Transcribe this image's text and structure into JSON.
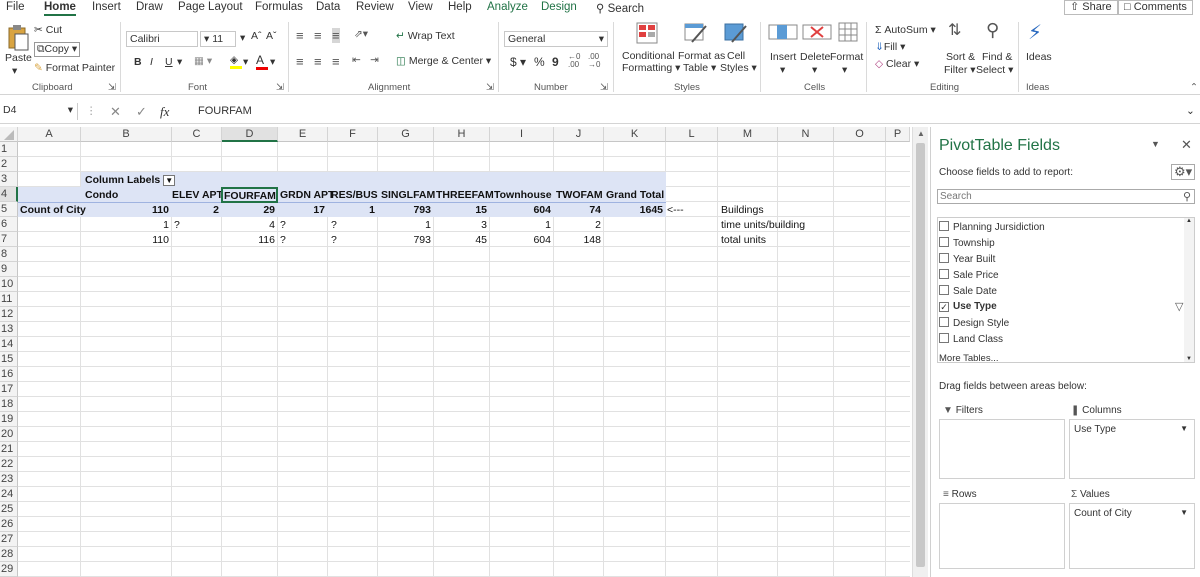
{
  "tabs": [
    "File",
    "Home",
    "Insert",
    "Draw",
    "Page Layout",
    "Formulas",
    "Data",
    "Review",
    "View",
    "Help",
    "Analyze",
    "Design"
  ],
  "search_label": "Search",
  "share_label": "Share",
  "comments_label": "Comments",
  "ribbon": {
    "paste": "Paste",
    "cut": "Cut",
    "copy": "Copy",
    "format_painter": "Format Painter",
    "clipboard": "Clipboard",
    "font_name": "Calibri",
    "font_size": "11",
    "font_group": "Font",
    "bold": "B",
    "italic": "I",
    "underline": "U",
    "wrap_text": "Wrap Text",
    "merge_center": "Merge & Center",
    "alignment": "Alignment",
    "number_format": "General",
    "currency": "$",
    "percent": "%",
    "comma": "9",
    "number": "Number",
    "conditional": "Conditional",
    "formatting": "Formatting",
    "format_as": "Format as",
    "table": "Table",
    "cell": "Cell",
    "cell_styles": "Styles",
    "styles": "Styles",
    "insert": "Insert",
    "delete": "Delete",
    "format": "Format",
    "cells": "Cells",
    "autosum": "AutoSum",
    "fill": "Fill",
    "clear": "Clear",
    "sort_filter": "Sort &",
    "filter": "Filter",
    "find_select": "Find &",
    "select": "Select",
    "editing": "Editing",
    "ideas": "Ideas",
    "ideas_group": "Ideas"
  },
  "formula_bar": {
    "name_box": "D4",
    "fx": "fx",
    "value": "FOURFAM"
  },
  "columns": [
    "A",
    "B",
    "C",
    "D",
    "E",
    "F",
    "G",
    "H",
    "I",
    "J",
    "K",
    "L",
    "M",
    "N",
    "O",
    "P"
  ],
  "rows": [
    "1",
    "2",
    "3",
    "4",
    "5",
    "6",
    "7",
    "8",
    "9",
    "10",
    "11",
    "12",
    "13",
    "14",
    "15",
    "16",
    "17",
    "18",
    "19",
    "20",
    "21",
    "22",
    "23",
    "24",
    "25",
    "26",
    "27",
    "28",
    "29"
  ],
  "cells": {
    "b3": "Column Labels",
    "b4": "Condo",
    "c4": "ELEV APT",
    "d4": "FOURFAM",
    "e4": "GRDN APT",
    "f4": "RES/BUS",
    "g4": "SINGLFAM",
    "h4": "THREEFAM",
    "i4": "Townhouse",
    "j4": "TWOFAM",
    "k4": "Grand Total",
    "a5": "Count of City",
    "b5": "110",
    "c5": "2",
    "d5": "29",
    "e5": "17",
    "f5": "1",
    "g5": "793",
    "h5": "15",
    "i5": "604",
    "j5": "74",
    "k5": "1645",
    "l5": "<---",
    "m5": "Buildings",
    "b6": "1",
    "c6": "?",
    "d6": "4",
    "e6": "?",
    "f6": "?",
    "g6": "1",
    "h6": "3",
    "i6": "1",
    "j6": "2",
    "m6": "time units/building",
    "b7": "110",
    "d7": "116",
    "e7": "?",
    "f7": "?",
    "g7": "793",
    "h7": "45",
    "i7": "604",
    "j7": "148",
    "m7": "total units"
  },
  "pivot": {
    "title": "PivotTable Fields",
    "subtitle": "Choose fields to add to report:",
    "search_placeholder": "Search",
    "fields": [
      {
        "label": "Planning Jursidiction",
        "checked": false
      },
      {
        "label": "Township",
        "checked": false
      },
      {
        "label": "Year Built",
        "checked": false
      },
      {
        "label": "Sale Price",
        "checked": false
      },
      {
        "label": "Sale Date",
        "checked": false
      },
      {
        "label": "Use Type",
        "checked": true
      },
      {
        "label": "Design Style",
        "checked": false
      },
      {
        "label": "Land Class",
        "checked": false
      }
    ],
    "more_tables": "More Tables...",
    "drag_label": "Drag fields between areas below:",
    "filters": "Filters",
    "columns": "Columns",
    "rows": "Rows",
    "values": "Values",
    "columns_item": "Use Type",
    "values_item": "Count of City"
  },
  "colors": {
    "accent": "#217346",
    "pivot_header": "#dde4f5",
    "selected": "#217346"
  }
}
